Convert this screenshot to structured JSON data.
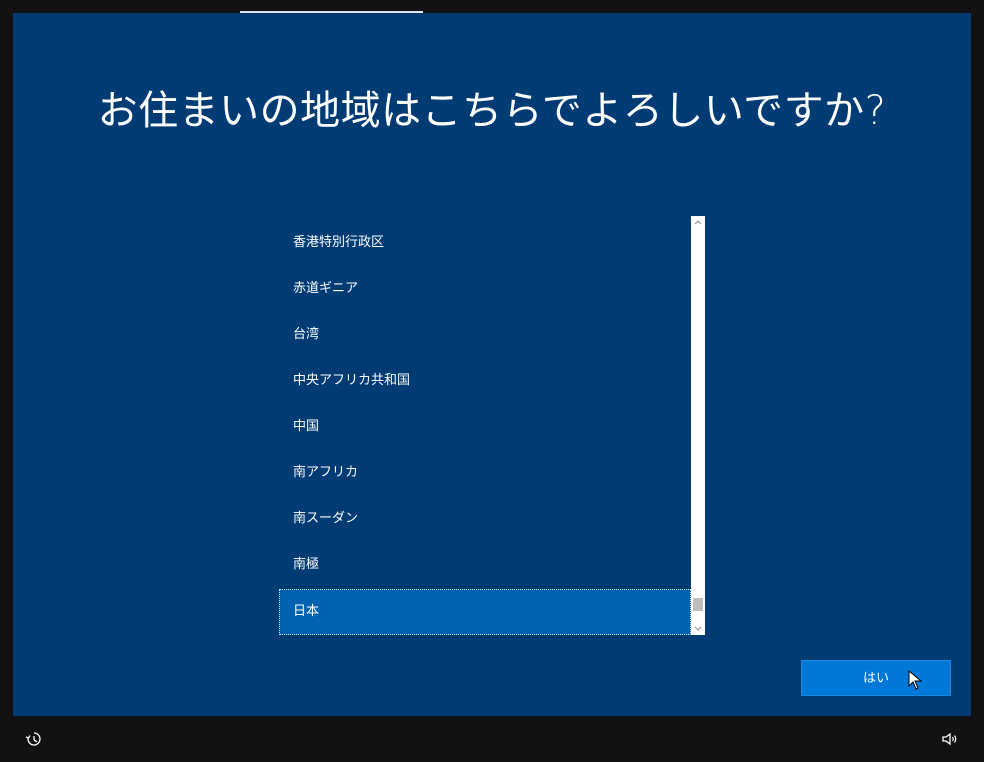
{
  "title": "お住まいの地域はこちらでよろしいですか?",
  "region_list": {
    "items": [
      {
        "label": "香港特別行政区",
        "selected": false
      },
      {
        "label": "赤道ギニア",
        "selected": false
      },
      {
        "label": "台湾",
        "selected": false
      },
      {
        "label": "中央アフリカ共和国",
        "selected": false
      },
      {
        "label": "中国",
        "selected": false
      },
      {
        "label": "南アフリカ",
        "selected": false
      },
      {
        "label": "南スーダン",
        "selected": false
      },
      {
        "label": "南極",
        "selected": false
      },
      {
        "label": "日本",
        "selected": true
      }
    ]
  },
  "buttons": {
    "yes_label": "はい"
  },
  "icons": {
    "ease_of_access": "ease-of-access-icon",
    "volume": "volume-icon"
  },
  "colors": {
    "panel": "#003b73",
    "selected": "#0063b1",
    "button": "#0078d7"
  }
}
